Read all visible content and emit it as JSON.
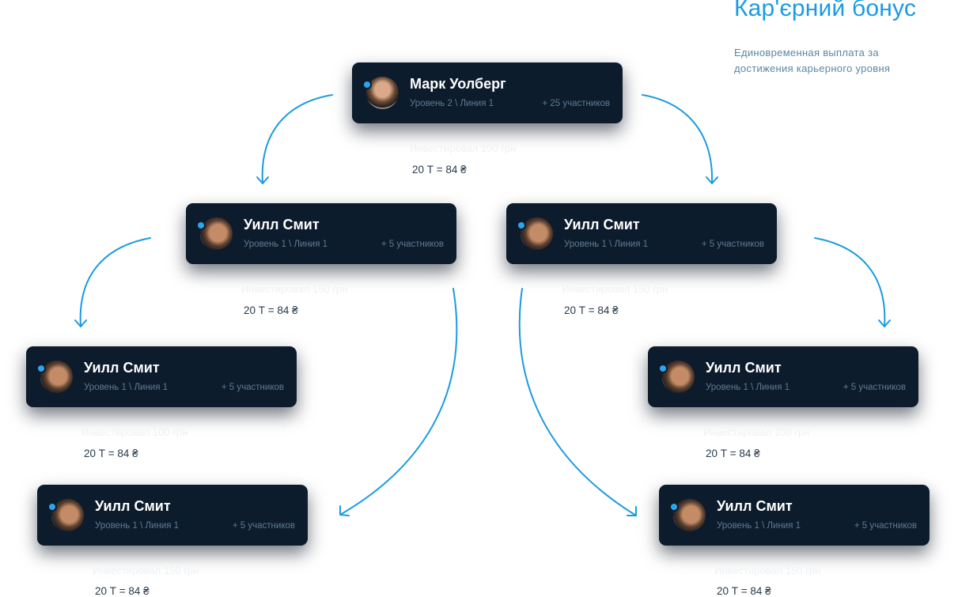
{
  "header": {
    "title": "Кар'єрний бонус",
    "subtitle": "Единовременная выплата за достижения карьерного уровня"
  },
  "colors": {
    "accent": "#1a9be0",
    "card_bg": "#0d1c2c",
    "online_dot": "#2ba5ec"
  },
  "nodes": [
    {
      "name": "Марк Уолберг",
      "level": "Уровень 2 \\ Линия 1",
      "count": "+ 25 участников",
      "invest": "Инвестировал 100 грн",
      "rate": "20 Т = 84 ₴",
      "avatar_icon": "user-avatar-icon"
    },
    {
      "name": "Уилл Смит",
      "level": "Уровень 1 \\ Линия 1",
      "count": "+ 5 участников",
      "invest": "Инвестировал 150 грн",
      "rate": "20 Т = 84 ₴",
      "avatar_icon": "user-avatar-icon"
    },
    {
      "name": "Уилл Смит",
      "level": "Уровень 1 \\ Линия 1",
      "count": "+ 5 участников",
      "invest": "Инвестировал 150 грн",
      "rate": "20 Т = 84 ₴",
      "avatar_icon": "user-avatar-icon"
    },
    {
      "name": "Уилл Смит",
      "level": "Уровень 1 \\ Линия 1",
      "count": "+ 5 участников",
      "invest": "Инвестировал 100 грн",
      "rate": "20 Т = 84 ₴",
      "avatar_icon": "user-avatar-icon"
    },
    {
      "name": "Уилл Смит",
      "level": "Уровень 1 \\ Линия 1",
      "count": "+ 5 участников",
      "invest": "Инвестировал 100 грн",
      "rate": "20 Т = 84 ₴",
      "avatar_icon": "user-avatar-icon"
    },
    {
      "name": "Уилл Смит",
      "level": "Уровень 1 \\ Линия 1",
      "count": "+ 5 участников",
      "invest": "Инвестировал 150 грн",
      "rate": "20 Т = 84 ₴",
      "avatar_icon": "user-avatar-icon"
    },
    {
      "name": "Уилл Смит",
      "level": "Уровень 1 \\ Линия 1",
      "count": "+ 5 участников",
      "invest": "Инвестировал 150 грн",
      "rate": "20 Т = 84 ₴",
      "avatar_icon": "user-avatar-icon"
    }
  ]
}
